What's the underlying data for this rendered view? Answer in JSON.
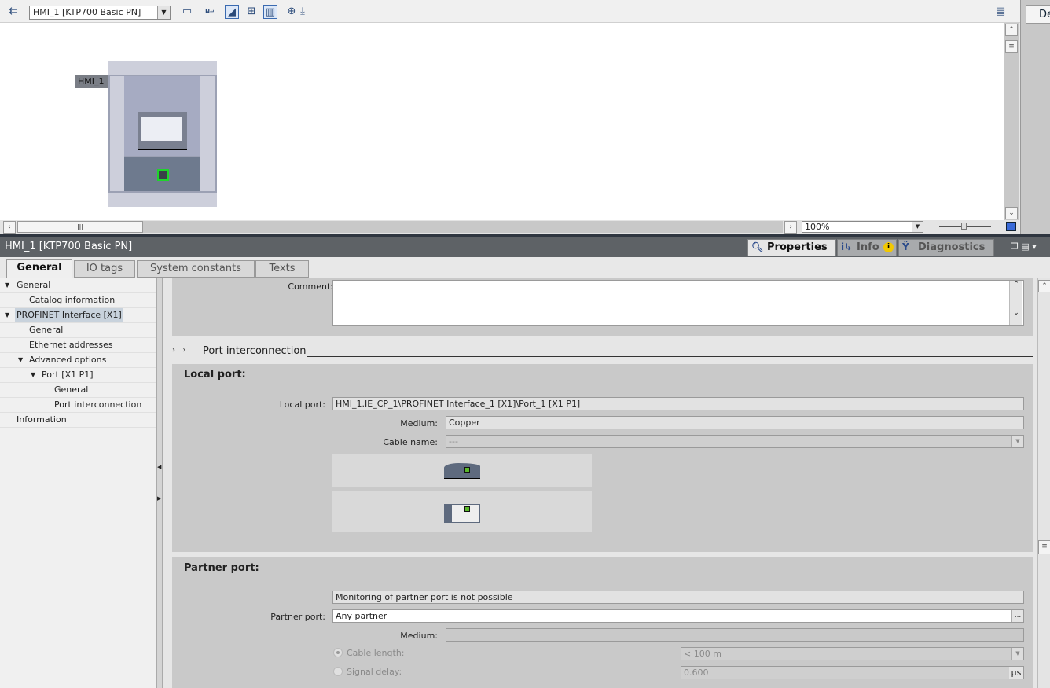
{
  "toolbar": {
    "device_select": "HMI_1 [KTP700 Basic PN]",
    "icons": [
      "network-view-icon",
      "show-address-icon",
      "name-icon",
      "highlight-icon",
      "grid-icon",
      "overview-icon",
      "zoom-icon",
      "download-icon"
    ]
  },
  "canvas": {
    "device_label": "HMI_1",
    "zoom": "100%"
  },
  "right_panel": {
    "tab": "De"
  },
  "inspector": {
    "title": "HMI_1 [KTP700 Basic PN]",
    "tabs": [
      {
        "label": "Properties",
        "icon": "properties-icon"
      },
      {
        "label": "Info",
        "icon": "info-icon"
      },
      {
        "label": "Diagnostics",
        "icon": "diagnostics-icon"
      }
    ]
  },
  "prop_tabs": [
    "General",
    "IO tags",
    "System constants",
    "Texts"
  ],
  "tree": [
    {
      "label": "General",
      "level": 0,
      "expanded": true
    },
    {
      "label": "Catalog information",
      "level": 1
    },
    {
      "label": "PROFINET Interface [X1]",
      "level": 0,
      "expanded": true,
      "selected": true
    },
    {
      "label": "General",
      "level": 1
    },
    {
      "label": "Ethernet addresses",
      "level": 1
    },
    {
      "label": "Advanced options",
      "level": 1,
      "expanded": true
    },
    {
      "label": "Port [X1 P1]",
      "level": 2,
      "expanded": true
    },
    {
      "label": "General",
      "level": 3
    },
    {
      "label": "Port interconnection",
      "level": 3
    },
    {
      "label": "Information",
      "level": 0
    }
  ],
  "form": {
    "comment_label": "Comment:",
    "comment_value": "",
    "section_title": "Port interconnection",
    "local": {
      "heading": "Local port:",
      "local_port_label": "Local port:",
      "local_port_value": "HMI_1.IE_CP_1\\PROFINET Interface_1 [X1]\\Port_1 [X1 P1]",
      "medium_label": "Medium:",
      "medium_value": "Copper",
      "cable_label": "Cable name:",
      "cable_value": "---"
    },
    "partner": {
      "heading": "Partner port:",
      "monitoring": "Monitoring of partner port is not possible",
      "partner_label": "Partner port:",
      "partner_value": "Any partner",
      "browse": "...",
      "medium_label": "Medium:",
      "medium_value": "",
      "cable_length_label": "Cable length:",
      "cable_length_value": "< 100 m",
      "signal_delay_label": "Signal delay:",
      "signal_delay_value": "0.600",
      "signal_delay_unit": "µs"
    }
  },
  "colors": {
    "link": "#5ab82a",
    "port_border": "#1a1a1a",
    "module": "#5e6a7e"
  }
}
